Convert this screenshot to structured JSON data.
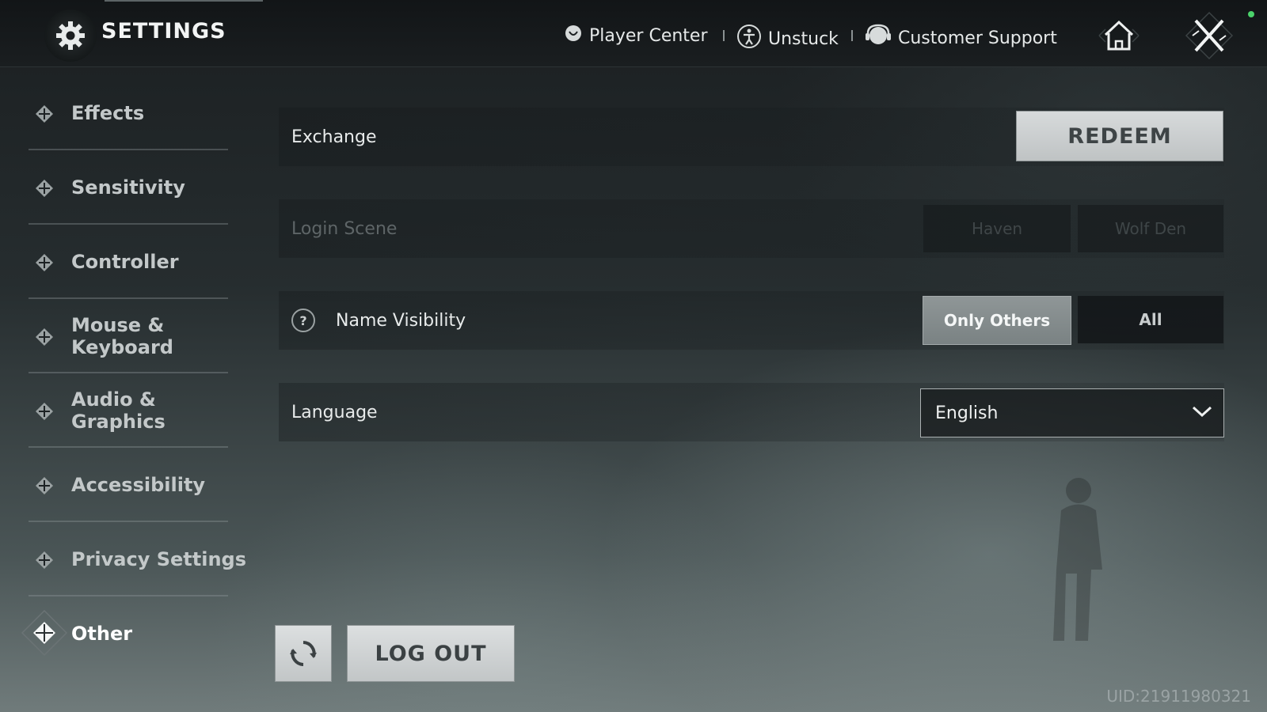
{
  "header": {
    "title": "SETTINGS",
    "links": [
      {
        "label": "Player Center",
        "icon": "player-center-icon"
      },
      {
        "label": "Unstuck",
        "icon": "unstuck-icon"
      },
      {
        "label": "Customer Support",
        "icon": "customer-support-icon"
      }
    ],
    "home_icon": "home-icon",
    "close_icon": "close-icon"
  },
  "sidebar": {
    "items": [
      {
        "label": "Effects",
        "active": false
      },
      {
        "label": "Sensitivity",
        "active": false
      },
      {
        "label": "Controller",
        "active": false
      },
      {
        "label": "Mouse & Keyboard",
        "active": false
      },
      {
        "label": "Audio & Graphics",
        "active": false
      },
      {
        "label": "Accessibility",
        "active": false
      },
      {
        "label": "Privacy Settings",
        "active": false
      },
      {
        "label": "Other",
        "active": true
      }
    ]
  },
  "settings": {
    "exchange": {
      "label": "Exchange",
      "button": "REDEEM"
    },
    "login_scene": {
      "label": "Login Scene",
      "options": [
        "Haven",
        "Wolf Den"
      ],
      "disabled": true
    },
    "name_visibility": {
      "label": "Name Visibility",
      "help": "?",
      "options": [
        "Only Others",
        "All"
      ],
      "selected": "Only Others"
    },
    "language": {
      "label": "Language",
      "value": "English"
    }
  },
  "footer": {
    "logout_label": "LOG OUT",
    "reset_icon": "reset-icon",
    "uid": "UID:21911980321"
  },
  "colors": {
    "accent": "#8f9697",
    "active_toggle": "#7a8283",
    "online": "#4bd36b"
  }
}
